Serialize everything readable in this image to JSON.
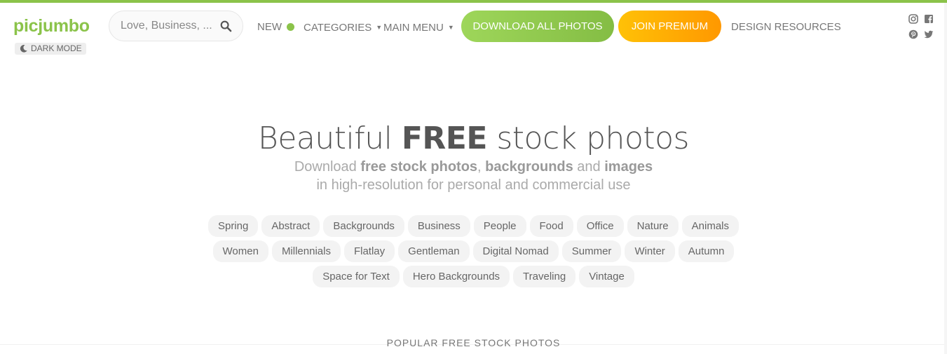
{
  "brand": {
    "logo": "picjumbo",
    "accent": "#8bc34a"
  },
  "dark_mode": {
    "label": "DARK MODE",
    "icon": "moon-icon"
  },
  "search": {
    "placeholder": "Love, Business, ...",
    "value": "",
    "icon": "search-icon"
  },
  "nav": {
    "new_label": "NEW",
    "categories_label": "CATEGORIES",
    "main_menu_label": "MAIN MENU",
    "caret": "▼",
    "design_resources_label": "DESIGN RESOURCES"
  },
  "buttons": {
    "download_all": {
      "label": "DOWNLOAD ALL PHOTOS",
      "color": "#8bc34a"
    },
    "join_premium": {
      "label": "JOIN PREMIUM",
      "color": "#ffa000"
    }
  },
  "social": [
    "instagram-icon",
    "facebook-icon",
    "pinterest-icon",
    "twitter-icon"
  ],
  "hero": {
    "title_pre": "Beautiful ",
    "title_bold": "FREE",
    "title_post": " stock photos",
    "sub1": {
      "a": "Download ",
      "b": "free stock photos",
      "c": ", ",
      "d": "backgrounds",
      "e": " and ",
      "f": "images"
    },
    "sub2": "in high-resolution for personal and commercial use"
  },
  "tags": [
    [
      "Spring",
      "Abstract",
      "Backgrounds",
      "Business",
      "People",
      "Food",
      "Office",
      "Nature",
      "Animals"
    ],
    [
      "Women",
      "Millennials",
      "Flatlay",
      "Gentleman",
      "Digital Nomad",
      "Summer",
      "Winter",
      "Autumn"
    ],
    [
      "Space for Text",
      "Hero Backgrounds",
      "Traveling",
      "Vintage"
    ]
  ],
  "popular_heading": "POPULAR FREE STOCK PHOTOS"
}
